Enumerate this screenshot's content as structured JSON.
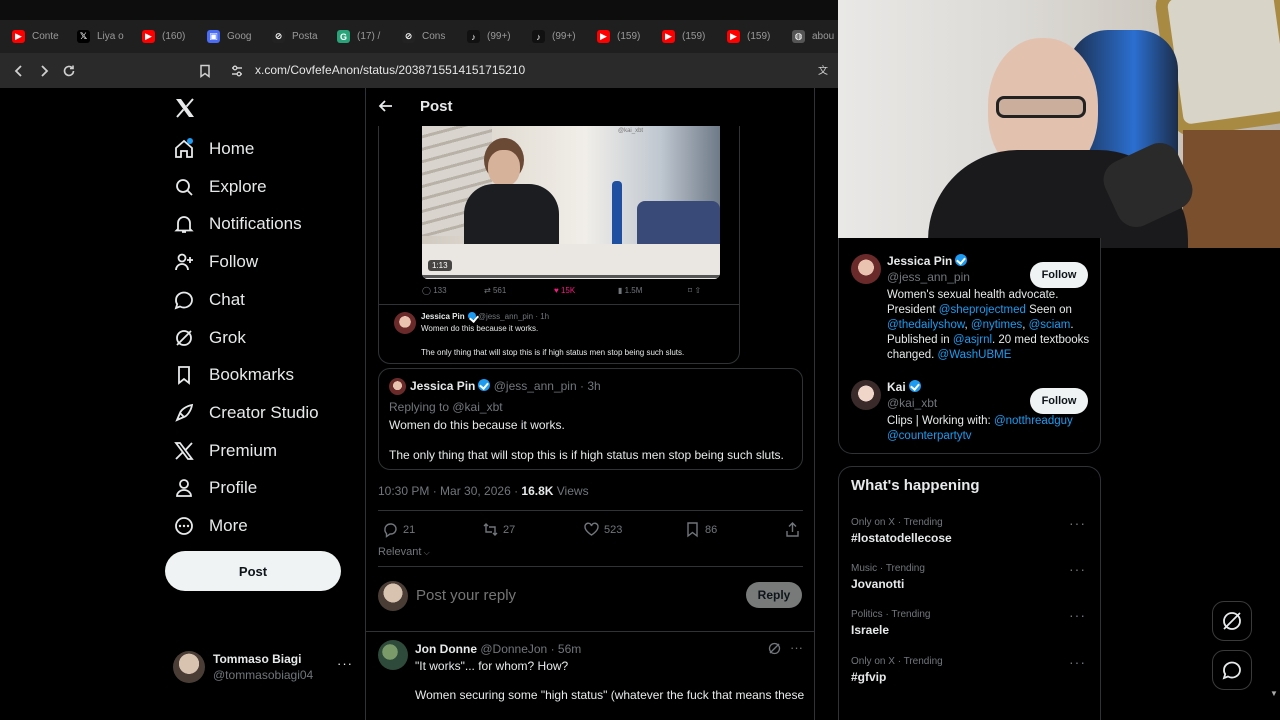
{
  "browser": {
    "tabs": [
      {
        "label": "Conte",
        "color": "#ff0000",
        "glyph": "▶"
      },
      {
        "label": "Liya o",
        "color": "#000000",
        "glyph": "𝕏"
      },
      {
        "label": "(160)",
        "color": "#ff0000",
        "glyph": "▶"
      },
      {
        "label": "Goog",
        "color": "#4a6cf7",
        "glyph": "▣"
      },
      {
        "label": "Posta",
        "color": "#222222",
        "glyph": "⊘"
      },
      {
        "label": "(17) /",
        "color": "#29a37a",
        "glyph": "G"
      },
      {
        "label": "Cons",
        "color": "#222222",
        "glyph": "⊘"
      },
      {
        "label": "(99+)",
        "color": "#111111",
        "glyph": "♪"
      },
      {
        "label": "(99+)",
        "color": "#111111",
        "glyph": "♪"
      },
      {
        "label": "(159)",
        "color": "#ff0000",
        "glyph": "▶"
      },
      {
        "label": "(159)",
        "color": "#ff0000",
        "glyph": "▶"
      },
      {
        "label": "(159)",
        "color": "#ff0000",
        "glyph": "▶"
      },
      {
        "label": "abou",
        "color": "#555555",
        "glyph": "◍"
      }
    ],
    "url": "x.com/CovfefeAnon/status/2038715514151715210"
  },
  "nav": {
    "items": [
      "Home",
      "Explore",
      "Notifications",
      "Follow",
      "Chat",
      "Grok",
      "Bookmarks",
      "Creator Studio",
      "Premium",
      "Profile",
      "More"
    ],
    "post_label": "Post"
  },
  "account": {
    "name": "Tommaso Biagi",
    "handle": "@tommasobiagi04"
  },
  "header": {
    "title": "Post"
  },
  "embed": {
    "video_duration": "1:13",
    "video_watermark": "@kai_xbt",
    "stats": {
      "replies": "133",
      "reposts": "561",
      "likes": "15K",
      "views": "1.5M"
    },
    "quoted": {
      "name": "Jessica Pin",
      "handle": "@jess_ann_pin",
      "time": "1h",
      "line1": "Women do this because it works.",
      "line2": "The only thing that will stop this is if high status men stop being such sluts."
    }
  },
  "quote": {
    "name": "Jessica Pin",
    "handle": "@jess_ann_pin",
    "time": "3h",
    "replying_prefix": "Replying to ",
    "replying_to": "@kai_xbt",
    "line1": "Women do this because it works.",
    "line2": "The only thing that will stop this is if high status men stop being such sluts."
  },
  "meta": {
    "timestamp": "10:30 PM · Mar 30, 2026 · ",
    "views_count": "16.8K",
    "views_label": " Views"
  },
  "actions": {
    "replies": "21",
    "reposts": "27",
    "likes": "523",
    "bookmarks": "86"
  },
  "sort": {
    "label": "Relevant"
  },
  "reply_box": {
    "placeholder": "Post your reply",
    "button": "Reply"
  },
  "reply": {
    "name": "Jon Donne",
    "handle": "@DonneJon",
    "time": "56m",
    "line1": "\"It works\"... for whom? How?",
    "line2": "Women securing some \"high status\" (whatever the fuck that means these"
  },
  "who_to_follow": [
    {
      "name": "Jessica Pin",
      "handle": "@jess_ann_pin",
      "follow": "Follow",
      "bio_parts": [
        "Women's sexual health advocate. President ",
        "@sheprojectmed",
        " Seen on ",
        "@thedailyshow",
        ", ",
        "@nytimes",
        ", ",
        "@sciam",
        ". Published in ",
        "@asjrnl",
        ". 20 med textbooks changed. ",
        "@WashUBME"
      ]
    },
    {
      "name": "Kai",
      "handle": "@kai_xbt",
      "follow": "Follow",
      "bio_parts": [
        "Clips | Working with: ",
        "@notthreadguy",
        " ",
        "@counterpartytv"
      ]
    }
  ],
  "whats_happening": {
    "title": "What's happening",
    "trends": [
      {
        "category": "Only on X · Trending",
        "name": "#lostatodellecose"
      },
      {
        "category": "Music · Trending",
        "name": "Jovanotti"
      },
      {
        "category": "Politics · Trending",
        "name": "Israele"
      },
      {
        "category": "Only on X · Trending",
        "name": "#gfvip"
      }
    ]
  },
  "colors": {
    "accent": "#1d9bf0",
    "like_pink": "#f91880",
    "bg": "#000000",
    "border": "#2f3336"
  }
}
